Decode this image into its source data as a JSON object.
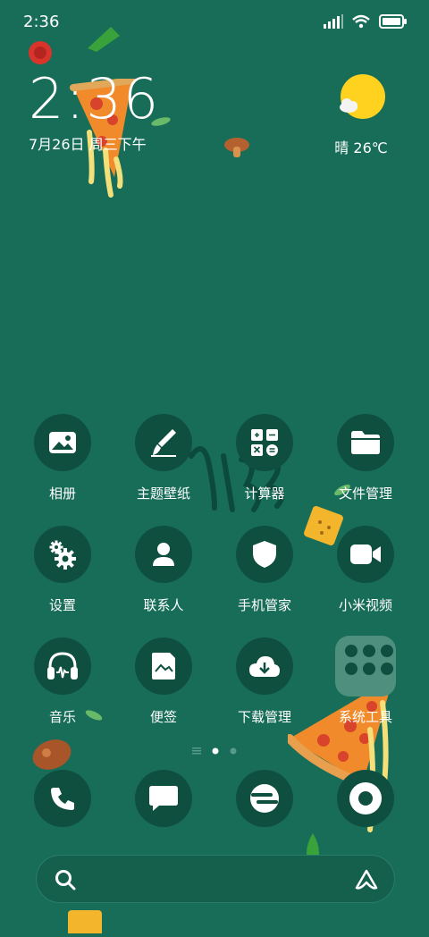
{
  "status_bar": {
    "time": "2:36",
    "icons": [
      "signal-icon",
      "wifi-icon",
      "battery-icon"
    ]
  },
  "clock_widget": {
    "time": "2:36",
    "date": "7月26日 周三下午"
  },
  "weather_widget": {
    "condition": "晴",
    "temperature": "26℃",
    "icon": "sunny-cloud-icon"
  },
  "apps_row1": [
    {
      "label": "相册",
      "icon": "gallery-icon"
    },
    {
      "label": "主题壁纸",
      "icon": "theme-brush-icon"
    },
    {
      "label": "计算器",
      "icon": "calculator-icon"
    },
    {
      "label": "文件管理",
      "icon": "folder-icon"
    }
  ],
  "apps_row2": [
    {
      "label": "设置",
      "icon": "gear-icon"
    },
    {
      "label": "联系人",
      "icon": "contact-icon"
    },
    {
      "label": "手机管家",
      "icon": "shield-icon"
    },
    {
      "label": "小米视频",
      "icon": "video-icon"
    }
  ],
  "apps_row3": [
    {
      "label": "音乐",
      "icon": "headphones-icon"
    },
    {
      "label": "便签",
      "icon": "notes-icon"
    },
    {
      "label": "下载管理",
      "icon": "download-icon"
    },
    {
      "label": "系统工具",
      "icon": "folder-icon"
    }
  ],
  "dock": [
    {
      "icon": "phone-icon"
    },
    {
      "icon": "message-icon"
    },
    {
      "icon": "browser-icon"
    },
    {
      "icon": "camera-icon"
    }
  ],
  "search": {
    "icon": "search-icon",
    "assistant_icon": "assistant-icon"
  },
  "colors": {
    "background": "#186d58",
    "icon_bg": "#0f4f40",
    "sun": "#ffd21f"
  }
}
